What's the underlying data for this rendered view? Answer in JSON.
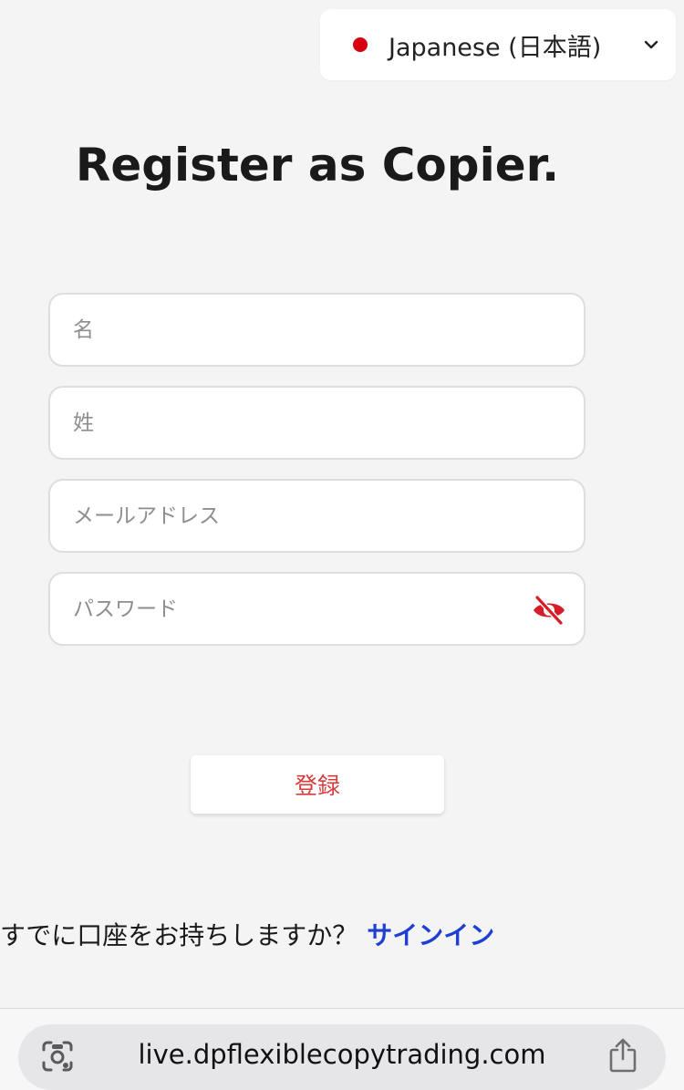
{
  "language_selector": {
    "label": "Japanese (日本語)",
    "flag_color": "#d70010",
    "icon": "chevron-down-icon"
  },
  "page": {
    "title": "Register as Copier."
  },
  "form": {
    "first_name_placeholder": "名",
    "last_name_placeholder": "姓",
    "email_placeholder": "メールアドレス",
    "password_placeholder": "パスワード",
    "password_toggle_icon": "eye-off-icon",
    "register_label": "登録"
  },
  "signin": {
    "prompt": "すでに口座をお持ちしますか？",
    "link_label": "サインイン"
  },
  "browser": {
    "url": "live.dpflexiblecopytrading.com",
    "left_icon": "visual-search-icon",
    "right_icon": "share-icon"
  },
  "colors": {
    "accent_red": "#d63c3c",
    "link_blue": "#1d3fd6",
    "background": "#f4f4f4"
  }
}
